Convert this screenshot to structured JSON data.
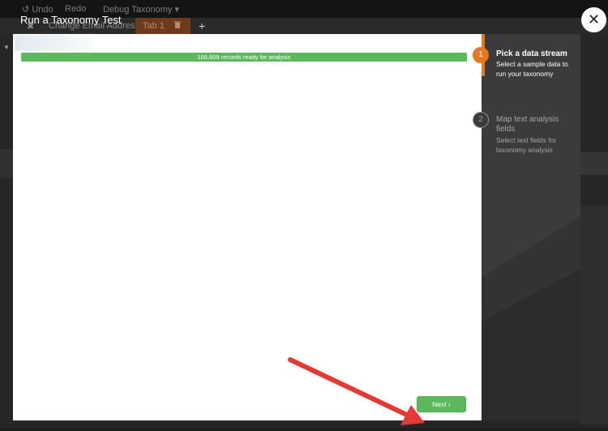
{
  "app": {
    "toolbar": {
      "undo_label": "↺ Undo",
      "redo_label": "Redo",
      "debug_label": "Debug Taxonomy ▾"
    },
    "tabs": {
      "close_glyph": "✖",
      "change_label": "Change Email Address",
      "active_tab_label": "Tab 1",
      "add_glyph": "+"
    }
  },
  "modal": {
    "title": "Run a Taxonomy Test",
    "close_glyph": "✕",
    "progress_text": "166,609 records ready for analysis",
    "progress_fraction": 1.0,
    "next_label": "Next ›"
  },
  "steps": [
    {
      "number": "1",
      "title": "Pick a data stream",
      "description": "Select a sample data to run your taxonomy",
      "state": "active"
    },
    {
      "number": "2",
      "title": "Map text analysis fields",
      "description": "Select text fields for taxonomy analysis",
      "state": "inactive"
    }
  ],
  "colors": {
    "accent_orange": "#e87722",
    "success_green": "#5cb85c",
    "arrow_red": "#e53935",
    "panel_dark": "#3b3b3b"
  },
  "icons": {
    "close": "close-icon",
    "trash": "trash-icon",
    "arrow": "annotation-arrow"
  }
}
